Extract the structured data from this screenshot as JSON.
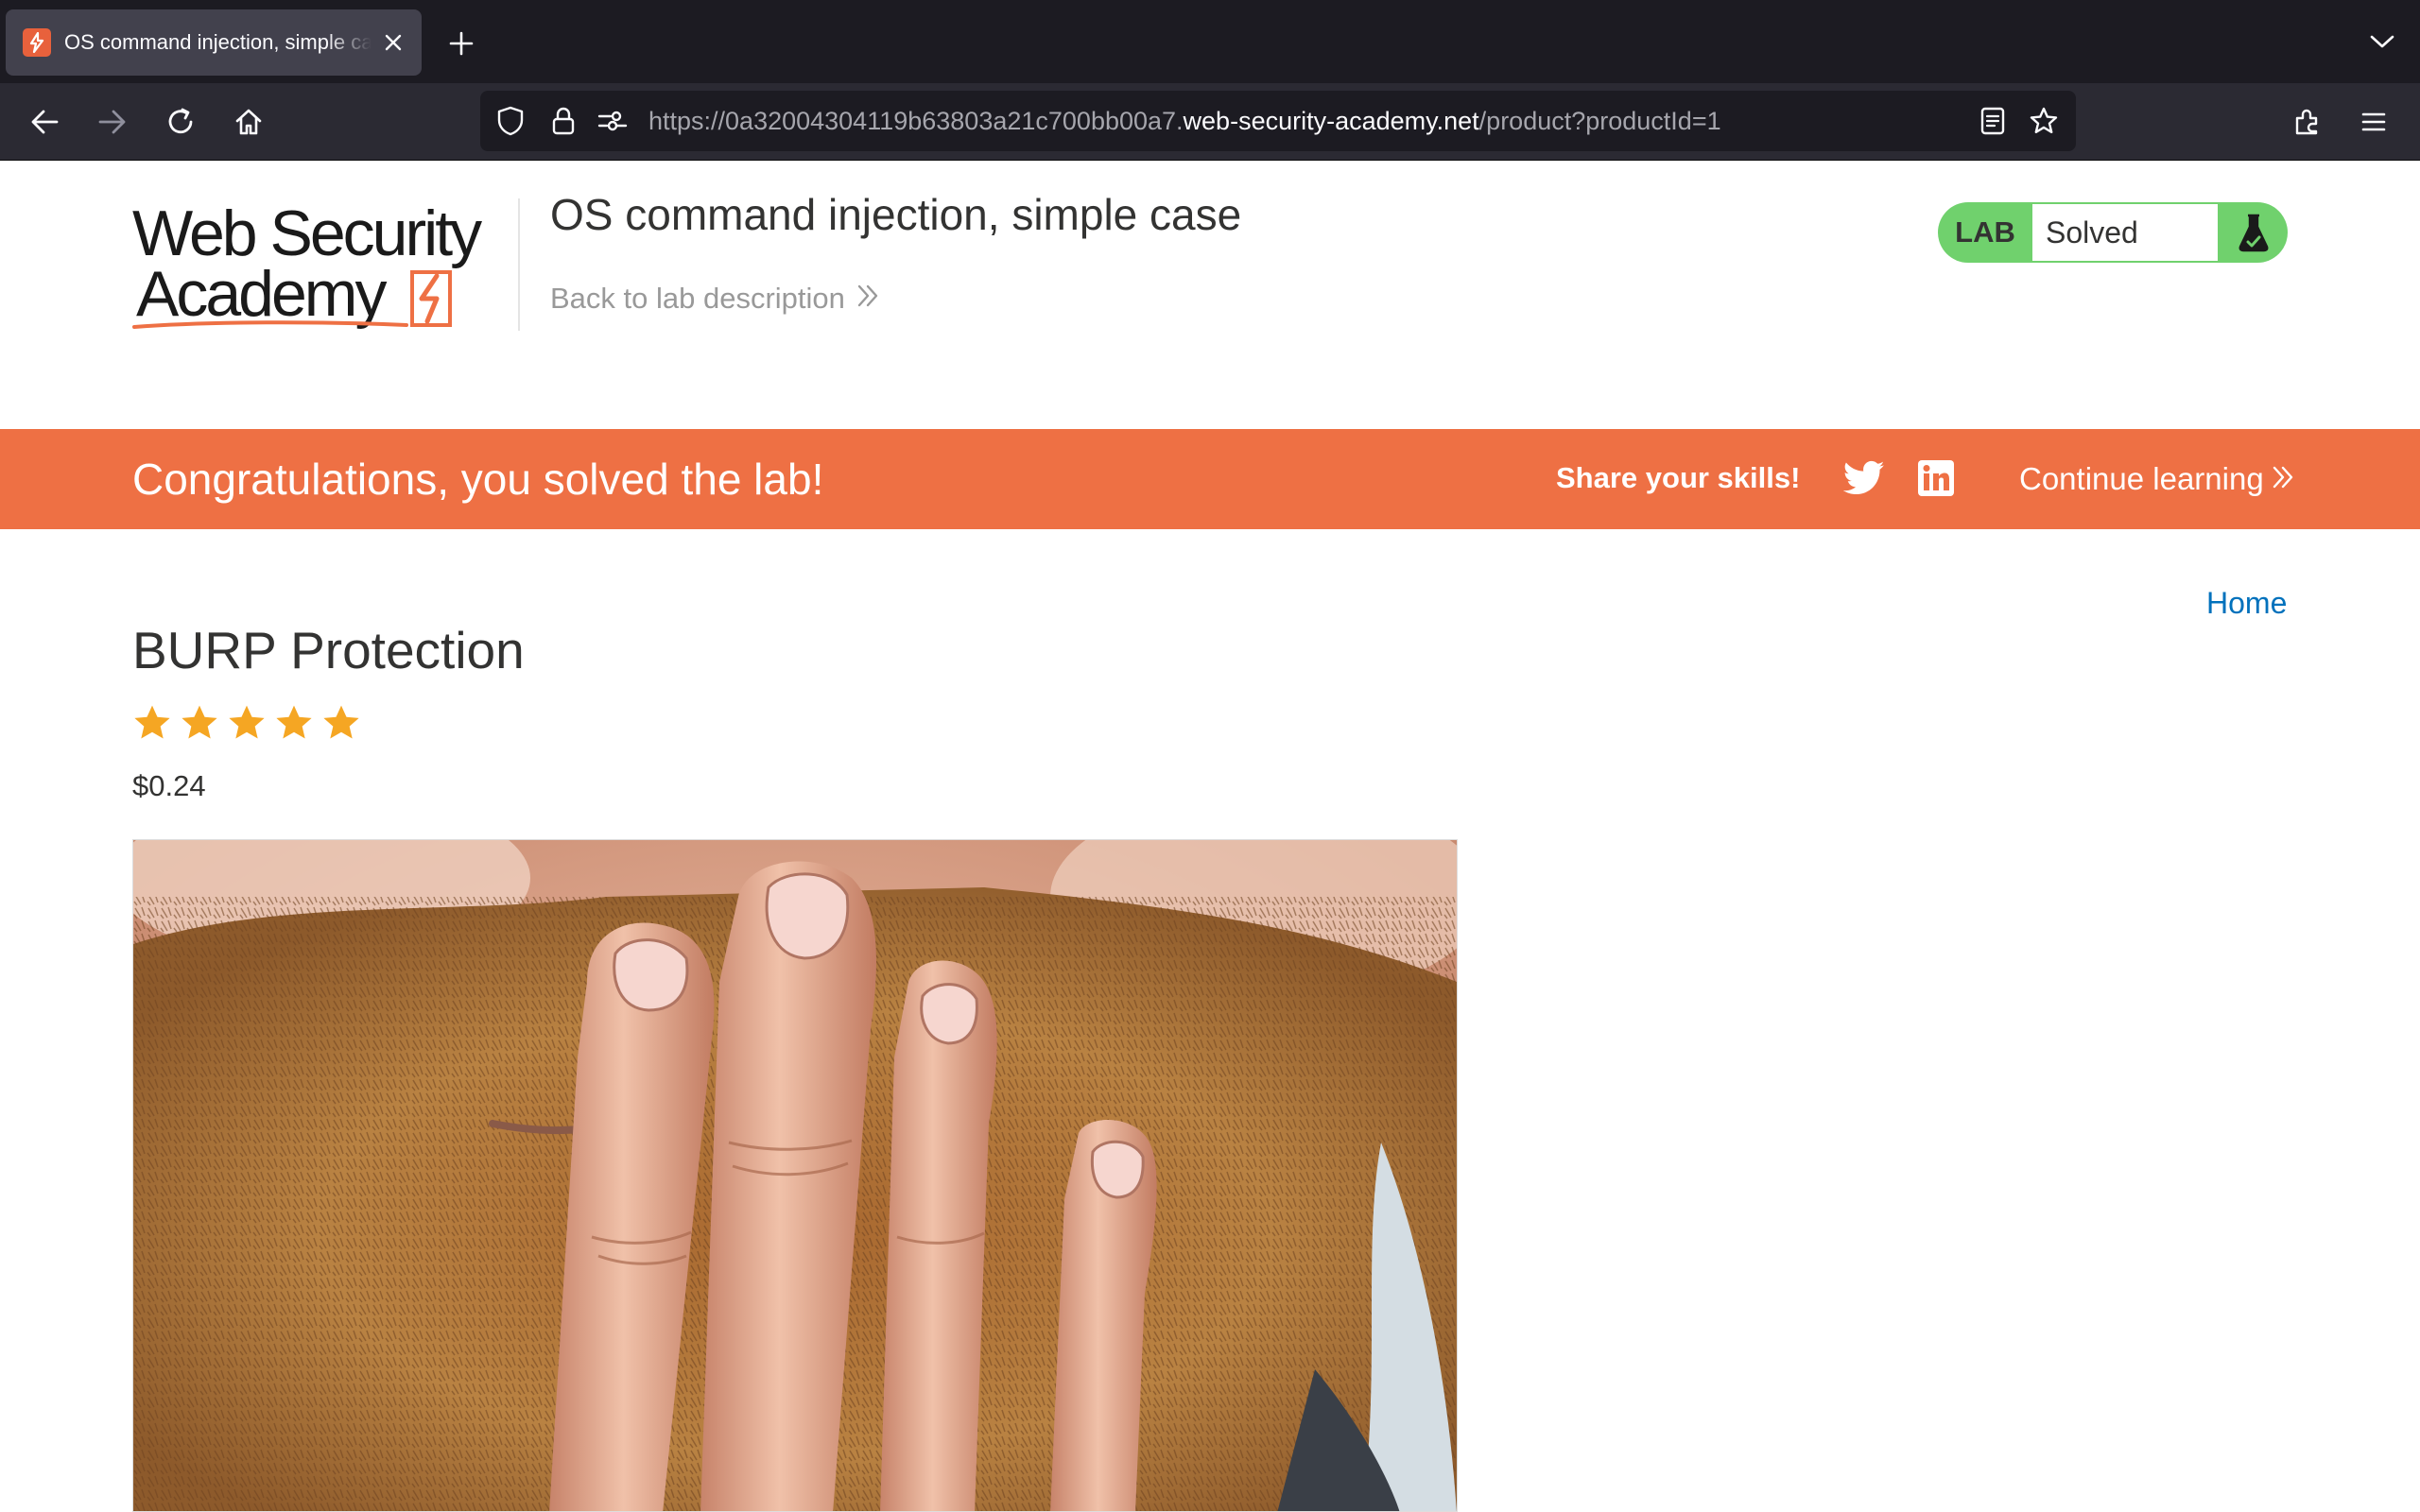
{
  "browser": {
    "tab_title": "OS command injection, simple case",
    "url_prefix": "https://0a32004304119b63803a21c700bb00a7.",
    "url_host": "web-security-academy.net",
    "url_path": "/product?productId=1"
  },
  "header": {
    "logo_line1": "Web Security",
    "logo_line2": "Academy",
    "lab_title": "OS command injection, simple case",
    "back_link": "Back to lab description",
    "lab_tag": "LAB",
    "lab_status": "Solved"
  },
  "banner": {
    "message": "Congratulations, you solved the lab!",
    "share_label": "Share your skills!",
    "continue_label": "Continue learning"
  },
  "nav": {
    "home": "Home"
  },
  "product": {
    "title": "BURP Protection",
    "rating": 5,
    "rating_max": 5,
    "price": "$0.24",
    "image_subject": "bearded man covering his mouth with his hand"
  },
  "colors": {
    "accent_orange": "#ee7044",
    "lab_green": "#70d16d",
    "link_blue": "#0071bc",
    "star_gold": "#f5a623",
    "browser_tabbar": "#1c1b22",
    "browser_navbar": "#2b2a33"
  },
  "icons": {
    "tab": "portswigger-favicon",
    "close": "close-icon",
    "newtab": "plus-icon",
    "nav": [
      "back-arrow-icon",
      "forward-arrow-icon",
      "reload-icon",
      "home-icon"
    ],
    "url": [
      "shield-icon",
      "lock-icon",
      "permissions-icon",
      "reader-view-icon",
      "bookmark-star-icon"
    ],
    "toolbar": [
      "extensions-icon",
      "hamburger-menu-icon"
    ],
    "page": [
      "double-chevron-icon",
      "twitter-icon",
      "linkedin-icon",
      "flask-icon",
      "star-icon"
    ]
  }
}
